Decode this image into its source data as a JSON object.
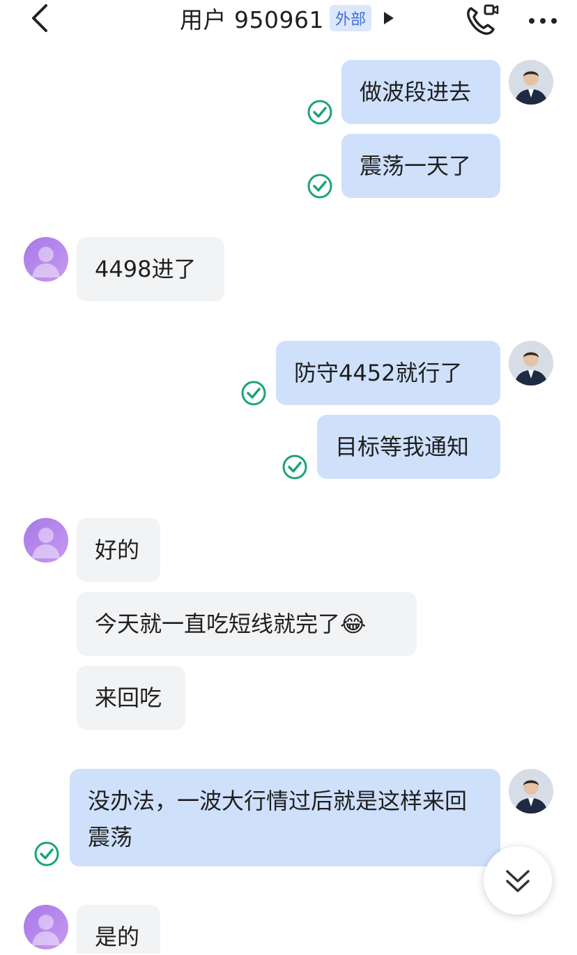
{
  "header": {
    "title": "用户 950961",
    "tag": "外部",
    "back_icon": "chevron-left-icon",
    "call_icon": "phone-video-icon",
    "more_icon": "more-horizontal-icon"
  },
  "messages": [
    {
      "sender": "me",
      "text": "做波段进去",
      "status": "read"
    },
    {
      "sender": "me",
      "text": "震荡一天了",
      "status": "read"
    },
    {
      "sender": "user",
      "text": "4498进了"
    },
    {
      "sender": "me",
      "text": "防守4452就行了",
      "status": "read"
    },
    {
      "sender": "me",
      "text": "目标等我通知",
      "status": "read"
    },
    {
      "sender": "user",
      "text": "好的"
    },
    {
      "sender": "user",
      "text": "今天就一直吃短线就完了😂"
    },
    {
      "sender": "user",
      "text": "来回吃"
    },
    {
      "sender": "me",
      "text": "没办法，一波大行情过后就是这样来回震荡",
      "status": "read"
    },
    {
      "sender": "user",
      "text": "是的"
    }
  ],
  "scroll_button": {
    "icon": "double-chevron-down-icon"
  },
  "colors": {
    "sent_bubble": "#cfe0fb",
    "recv_bubble": "#f2f3f5",
    "check": "#1aa37a",
    "tag_bg": "#dce7fb",
    "tag_text": "#3f6fd8"
  }
}
